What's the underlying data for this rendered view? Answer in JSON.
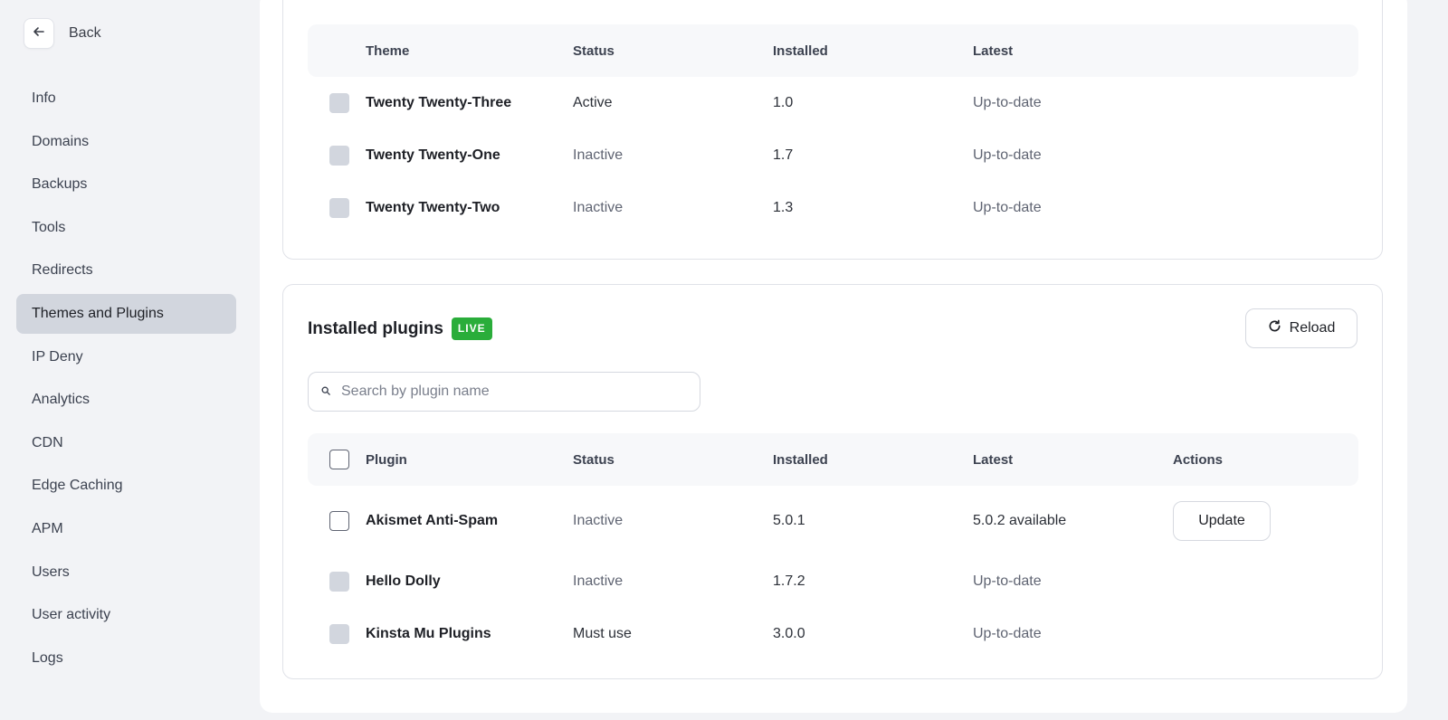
{
  "sidebar": {
    "back_label": "Back",
    "items": [
      {
        "label": "Info"
      },
      {
        "label": "Domains"
      },
      {
        "label": "Backups"
      },
      {
        "label": "Tools"
      },
      {
        "label": "Redirects"
      },
      {
        "label": "Themes and Plugins",
        "active": true
      },
      {
        "label": "IP Deny"
      },
      {
        "label": "Analytics"
      },
      {
        "label": "CDN"
      },
      {
        "label": "Edge Caching"
      },
      {
        "label": "APM"
      },
      {
        "label": "Users"
      },
      {
        "label": "User activity"
      },
      {
        "label": "Logs"
      }
    ]
  },
  "themes": {
    "headers": {
      "theme": "Theme",
      "status": "Status",
      "installed": "Installed",
      "latest": "Latest"
    },
    "rows": [
      {
        "name": "Twenty Twenty-Three",
        "status": "Active",
        "installed": "1.0",
        "latest": "Up-to-date"
      },
      {
        "name": "Twenty Twenty-One",
        "status": "Inactive",
        "installed": "1.7",
        "latest": "Up-to-date"
      },
      {
        "name": "Twenty Twenty-Two",
        "status": "Inactive",
        "installed": "1.3",
        "latest": "Up-to-date"
      }
    ]
  },
  "plugins": {
    "title": "Installed plugins",
    "badge": "LIVE",
    "reload_label": "Reload",
    "search_placeholder": "Search by plugin name",
    "headers": {
      "plugin": "Plugin",
      "status": "Status",
      "installed": "Installed",
      "latest": "Latest",
      "actions": "Actions"
    },
    "rows": [
      {
        "name": "Akismet Anti-Spam",
        "status": "Inactive",
        "installed": "5.0.1",
        "latest": "5.0.2 available",
        "action": "Update"
      },
      {
        "name": "Hello Dolly",
        "status": "Inactive",
        "installed": "1.7.2",
        "latest": "Up-to-date"
      },
      {
        "name": "Kinsta Mu Plugins",
        "status": "Must use",
        "installed": "3.0.0",
        "latest": "Up-to-date"
      }
    ]
  },
  "colors": {
    "accent_live": "#2aad3a",
    "active_nav_bg": "#d2d6de",
    "page_bg": "#f2f3f6"
  }
}
